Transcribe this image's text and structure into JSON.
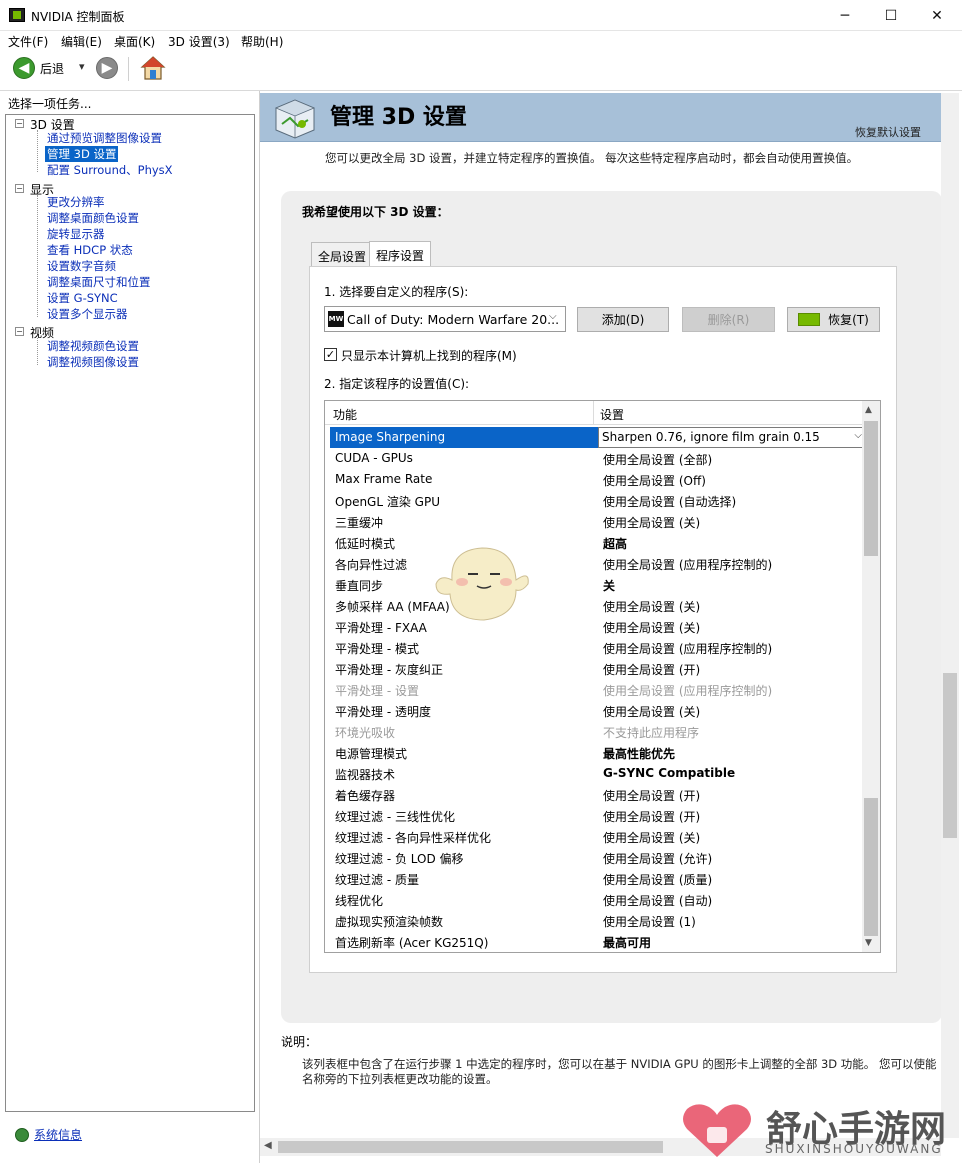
{
  "window": {
    "title": "NVIDIA 控制面板",
    "min_symbol": "─",
    "max_symbol": "☐",
    "close_symbol": "✕"
  },
  "menu": [
    "文件(F)",
    "编辑(E)",
    "桌面(K)",
    "3D 设置(3)",
    "帮助(H)"
  ],
  "toolbar": {
    "back_label": "后退",
    "dropdown_glyph": "▾"
  },
  "left_pane": {
    "header": "选择一项任务...",
    "tree": [
      {
        "category": "3D 设置",
        "items": [
          "通过预览调整图像设置",
          "管理 3D 设置",
          "配置 Surround、PhysX"
        ]
      },
      {
        "category": "显示",
        "items": [
          "更改分辨率",
          "调整桌面颜色设置",
          "旋转显示器",
          "查看 HDCP 状态",
          "设置数字音频",
          "调整桌面尺寸和位置",
          "设置 G-SYNC",
          "设置多个显示器"
        ]
      },
      {
        "category": "视频",
        "items": [
          "调整视频颜色设置",
          "调整视频图像设置"
        ]
      }
    ],
    "selected_item": "管理 3D 设置",
    "system_info": "系统信息"
  },
  "page": {
    "title": "管理 3D 设置",
    "restore_defaults": "恢复默认设置",
    "intro": "您可以更改全局 3D 设置，并建立特定程序的置换值。 每次这些特定程序启动时，都会自动使用置换值。",
    "panel_label": "我希望使用以下 3D 设置：",
    "tabs": [
      "全局设置",
      "程序设置"
    ],
    "active_tab": "程序设置",
    "step1": "1. 选择要自定义的程序(S):",
    "program": {
      "icon_text": "MW",
      "name": "Call of Duty: Modern Warfare 20...",
      "arrow": "⌵"
    },
    "buttons": {
      "add": "添加(D)",
      "remove": "删除(R)",
      "restore": "恢复(T)"
    },
    "checkbox": {
      "label": "只显示本计算机上找到的程序(M)",
      "checked": true,
      "mark": "✓"
    },
    "step2": "2. 指定该程序的设置值(C):",
    "grid": {
      "headers": [
        "功能",
        "设置"
      ],
      "rows": [
        {
          "feature": "Image Sharpening",
          "setting": "Sharpen 0.76, ignore film grain 0.15",
          "selected": true
        },
        {
          "feature": "CUDA - GPUs",
          "setting": "使用全局设置 (全部)"
        },
        {
          "feature": "Max Frame Rate",
          "setting": "使用全局设置 (Off)"
        },
        {
          "feature": "OpenGL 渲染 GPU",
          "setting": "使用全局设置 (自动选择)"
        },
        {
          "feature": "三重缓冲",
          "setting": "使用全局设置 (关)"
        },
        {
          "feature": "低延时模式",
          "setting": "超高",
          "bold": true
        },
        {
          "feature": "各向异性过滤",
          "setting": "使用全局设置 (应用程序控制的)"
        },
        {
          "feature": "垂直同步",
          "setting": "关",
          "bold": true
        },
        {
          "feature": "多帧采样 AA (MFAA)",
          "setting": "使用全局设置 (关)"
        },
        {
          "feature": "平滑处理 - FXAA",
          "setting": "使用全局设置 (关)"
        },
        {
          "feature": "平滑处理 - 模式",
          "setting": "使用全局设置 (应用程序控制的)"
        },
        {
          "feature": "平滑处理 - 灰度纠正",
          "setting": "使用全局设置 (开)"
        },
        {
          "feature": "平滑处理 - 设置",
          "setting": "使用全局设置 (应用程序控制的)",
          "gray": true
        },
        {
          "feature": "平滑处理 - 透明度",
          "setting": "使用全局设置 (关)"
        },
        {
          "feature": "环境光吸收",
          "setting": "不支持此应用程序",
          "gray": true
        },
        {
          "feature": "电源管理模式",
          "setting": "最高性能优先",
          "bold": true
        },
        {
          "feature": "监视器技术",
          "setting": "G-SYNC Compatible",
          "bold": true
        },
        {
          "feature": "着色缓存器",
          "setting": "使用全局设置 (开)"
        },
        {
          "feature": "纹理过滤 - 三线性优化",
          "setting": "使用全局设置 (开)"
        },
        {
          "feature": "纹理过滤 - 各向异性采样优化",
          "setting": "使用全局设置 (关)"
        },
        {
          "feature": "纹理过滤 - 负 LOD 偏移",
          "setting": "使用全局设置 (允许)"
        },
        {
          "feature": "纹理过滤 - 质量",
          "setting": "使用全局设置 (质量)"
        },
        {
          "feature": "线程优化",
          "setting": "使用全局设置 (自动)"
        },
        {
          "feature": "虚拟现实预渲染帧数",
          "setting": "使用全局设置 (1)"
        },
        {
          "feature": "首选刷新率 (Acer KG251Q)",
          "setting": "最高可用",
          "bold": true
        }
      ]
    },
    "explain_label": "说明：",
    "explain_text": "该列表框中包含了在运行步骤 1 中选定的程序时，您可以在基于 NVIDIA GPU 的图形卡上调整的全部 3D 功能。 您可以使能名称旁的下拉列表框更改功能的设置。"
  },
  "watermark": {
    "text": "舒心手游网",
    "sub": "SHUXINSHOUYOUWANG"
  },
  "colors": {
    "selection": "#0a64c8",
    "banner": "#a7c0d8",
    "link": "#0b2fb8",
    "nvidia_green": "#76b900"
  }
}
